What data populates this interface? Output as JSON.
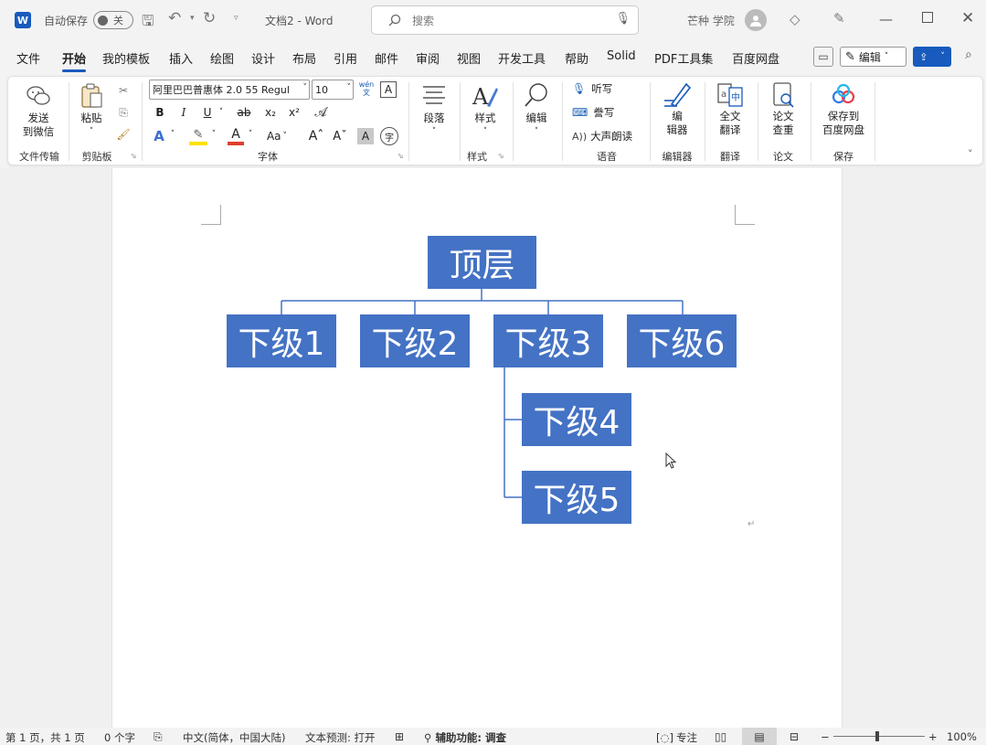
{
  "titlebar": {
    "autosave_label": "自动保存",
    "autosave_state": "关",
    "document_title": "文档2 - Word",
    "search_placeholder": "搜索",
    "user_name": "芒种 学院"
  },
  "menu": {
    "items": [
      "文件",
      "开始",
      "我的模板",
      "插入",
      "绘图",
      "设计",
      "布局",
      "引用",
      "邮件",
      "审阅",
      "视图",
      "开发工具",
      "帮助",
      "Solid",
      "PDF工具集",
      "百度网盘"
    ],
    "active": "开始",
    "edit_label": "编辑"
  },
  "ribbon": {
    "send_wechat": "发送\n到微信",
    "group_file_transfer": "文件传输",
    "paste": "粘贴",
    "group_clipboard": "剪贴板",
    "font_name": "阿里巴巴普惠体 2.0 55 Regul",
    "font_size": "10",
    "group_font": "字体",
    "paragraph": "段落",
    "style": "样式",
    "group_style": "样式",
    "editing": "编辑",
    "dictate": "听写",
    "dictate2": "誊写",
    "read_aloud": "大声朗读",
    "group_voice": "语音",
    "editor": "编\n辑器",
    "group_editor": "编辑器",
    "translate": "全文\n翻译",
    "group_translate": "翻译",
    "paper_check": "论文\n查重",
    "group_paper": "论文",
    "save_baidu": "保存到\n百度网盘",
    "group_save": "保存",
    "btn_bold": "B",
    "btn_italic": "I",
    "btn_underline": "U",
    "btn_strike": "ab",
    "btn_sub": "x₂",
    "btn_sup": "x²",
    "btn_case": "Aa",
    "btn_grow": "A^",
    "btn_shrink": "A˅",
    "btn_phonetic": "wén文",
    "btn_char_shade": "A",
    "btn_enclose": "字",
    "btn_border_char": "A"
  },
  "org_chart": {
    "top": "顶层",
    "children": [
      "下级1",
      "下级2",
      "下级3",
      "下级6"
    ],
    "sub_children": [
      "下级4",
      "下级5"
    ]
  },
  "status": {
    "page": "第 1 页，共 1 页",
    "words": "0 个字",
    "language": "中文(简体，中国大陆)",
    "predict": "文本预测: 打开",
    "accessibility": "辅助功能: 调查",
    "focus": "专注",
    "zoom": "100%"
  },
  "colors": {
    "accent": "#185abd",
    "node_fill": "#4472c4",
    "connector": "#4472c4"
  }
}
